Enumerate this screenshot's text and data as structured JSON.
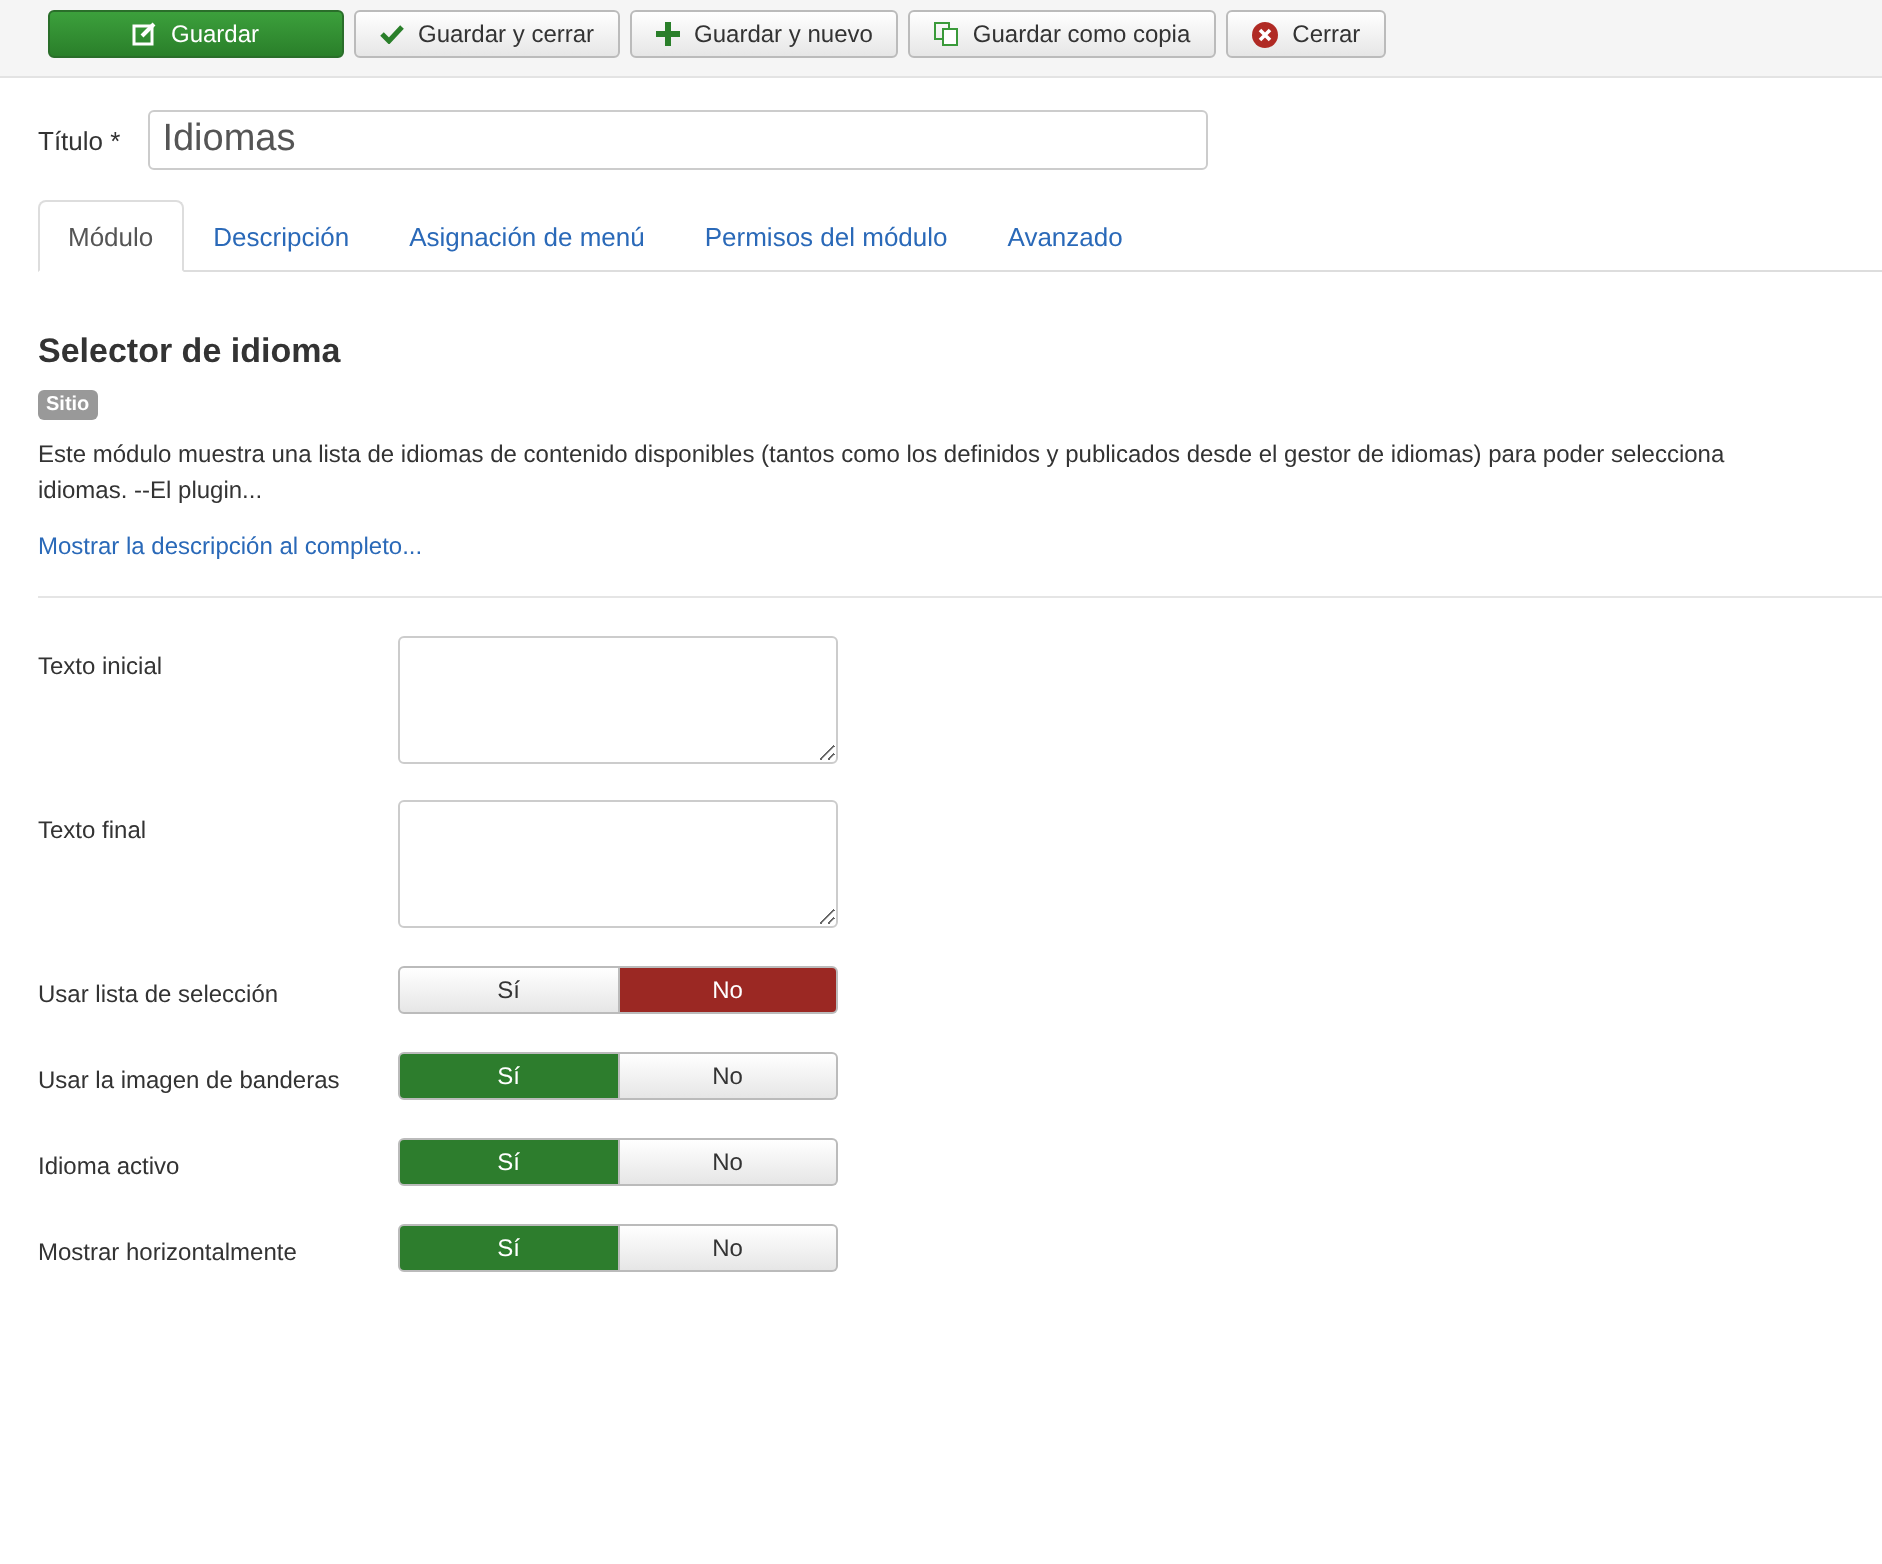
{
  "toolbar": [
    {
      "label": "Guardar",
      "kind": "save",
      "primary": true
    },
    {
      "label": "Guardar y cerrar",
      "kind": "check",
      "primary": false
    },
    {
      "label": "Guardar y nuevo",
      "kind": "plus",
      "primary": false
    },
    {
      "label": "Guardar como copia",
      "kind": "copy",
      "primary": false
    },
    {
      "label": "Cerrar",
      "kind": "close",
      "primary": false
    }
  ],
  "title_field": {
    "label": "Título *",
    "value": "Idiomas"
  },
  "tabs": [
    {
      "label": "Módulo",
      "selected": true
    },
    {
      "label": "Descripción",
      "selected": false
    },
    {
      "label": "Asignación de menú",
      "selected": false
    },
    {
      "label": "Permisos del módulo",
      "selected": false
    },
    {
      "label": "Avanzado",
      "selected": false
    }
  ],
  "module": {
    "heading": "Selector de idioma",
    "badge": "Sitio",
    "description_lines": [
      "Este módulo muestra una lista de idiomas de contenido disponibles (tantos como los definidos y publicados desde el gestor de idiomas) para poder selecciona",
      "idiomas. --El plugin..."
    ],
    "more_link": "Mostrar la descripción al completo..."
  },
  "fields": [
    {
      "kind": "textarea",
      "label": "Texto inicial"
    },
    {
      "kind": "textarea",
      "label": "Texto final"
    },
    {
      "kind": "switch",
      "label": "Usar lista de selección",
      "options": [
        {
          "label": "Sí",
          "kind": "yes",
          "selected": false
        },
        {
          "label": "No",
          "kind": "no",
          "selected": true
        }
      ]
    },
    {
      "kind": "switch",
      "label": "Usar la imagen de banderas",
      "options": [
        {
          "label": "Sí",
          "kind": "yes",
          "selected": true
        },
        {
          "label": "No",
          "kind": "no",
          "selected": false
        }
      ]
    },
    {
      "kind": "switch",
      "label": "Idioma activo",
      "options": [
        {
          "label": "Sí",
          "kind": "yes",
          "selected": true
        },
        {
          "label": "No",
          "kind": "no",
          "selected": false
        }
      ]
    },
    {
      "kind": "switch",
      "label": "Mostrar horizontalmente",
      "options": [
        {
          "label": "Sí",
          "kind": "yes",
          "selected": true
        },
        {
          "label": "No",
          "kind": "no",
          "selected": false
        }
      ]
    }
  ]
}
